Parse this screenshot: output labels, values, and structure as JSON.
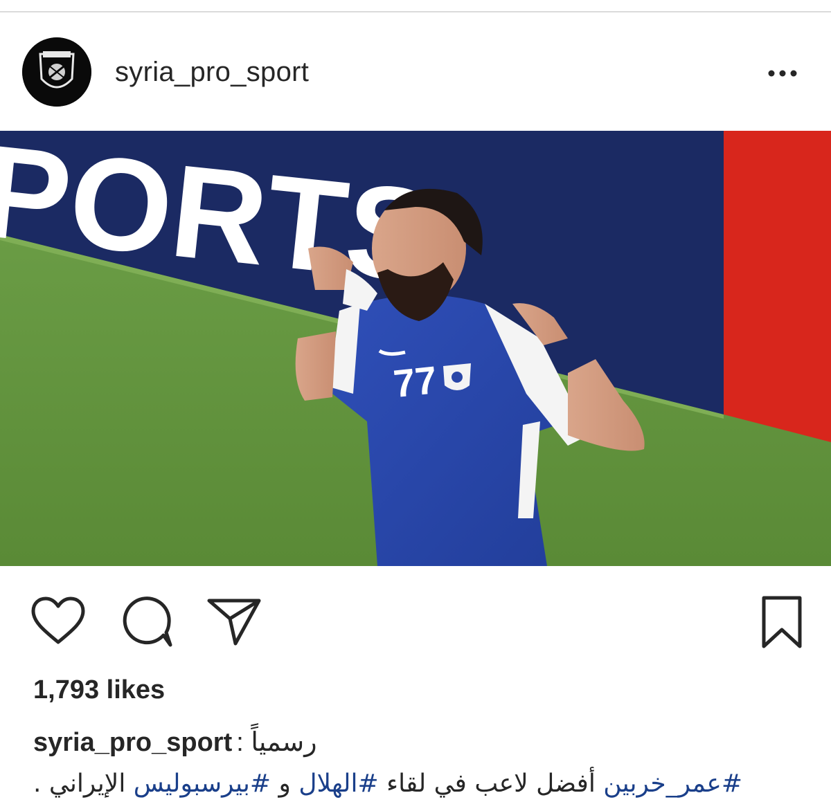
{
  "post": {
    "username": "syria_pro_sport",
    "more_label": "•••",
    "media": {
      "banner_text": "PORTS",
      "jersey_number": "77"
    },
    "actions": {
      "like_icon": "heart-icon",
      "comment_icon": "comment-icon",
      "share_icon": "send-icon",
      "save_icon": "bookmark-icon"
    },
    "likes": "1,793 likes",
    "caption": {
      "username": "syria_pro_sport",
      "line1_text": "رسمياً :",
      "line2_parts": [
        {
          "text": "#عمر_خربين",
          "tag": true
        },
        {
          "text": " أفضل لاعب في لقاء ",
          "tag": false
        },
        {
          "text": "#الهلال",
          "tag": true
        },
        {
          "text": " و ",
          "tag": false
        },
        {
          "text": "#بيرسبوليس",
          "tag": true
        },
        {
          "text": "  الإيراني .",
          "tag": false
        }
      ]
    }
  },
  "colors": {
    "text": "#262626",
    "hashtag": "#1a3f8a",
    "banner_blue": "#1b2a63",
    "banner_red": "#d8261c",
    "pitch_green": "#5a8f3a",
    "jersey_blue": "#2a47a8"
  }
}
